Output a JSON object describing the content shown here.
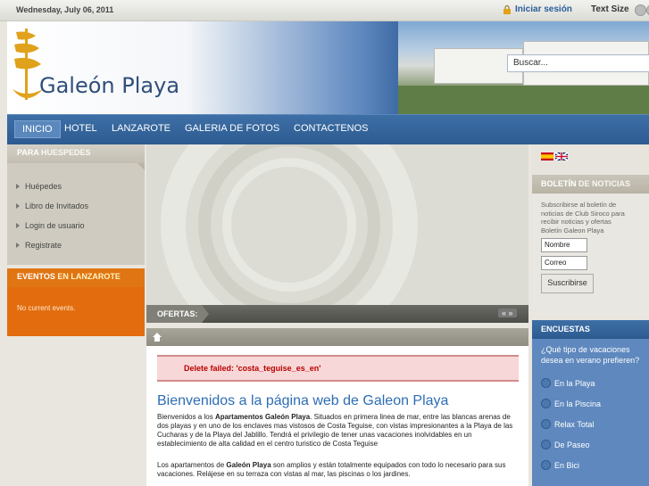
{
  "topbar": {
    "date": "Wednesday, July 06, 2011",
    "login": "Iniciar sesión",
    "text_size": "Text Size"
  },
  "header": {
    "logo_text": "Galeón Playa",
    "search_placeholder": "Buscar..."
  },
  "nav": {
    "items": [
      "INICIO",
      "HOTEL",
      "LANZAROTE",
      "GALERIA DE FOTOS",
      "CONTACTENOS"
    ]
  },
  "left": {
    "guest_title_a": "PARA ",
    "guest_title_b": "HUESPEDES",
    "menu": [
      "Huépedes",
      "Libro de Invitados",
      "Login de usuario",
      "Registrate"
    ],
    "events_title_a": "EVENTOS ",
    "events_title_b": "EN LANZAROTE",
    "events_text": "No current events."
  },
  "center": {
    "ofertas_label": "OFERTAS:",
    "arrows": "« »",
    "error": "Delete failed: 'costa_teguise_es_en'",
    "welcome": "Bienvenidos a la página web de Galeon Playa",
    "p1_a": "Bienvenidos a los ",
    "p1_b": "Apartamentos Galeón Playa",
    "p1_c": ". Situados en primera linea de mar, entre las blancas arenas de dos playas y en uno de los enclaves mas vistosos de Costa Teguise, con vistas impresionantes a la Playa de las Cucharas y de la Playa del Jablillo. Tendrá el privilegio de tener unas vacaciones inolvidables en un establecimiento de alta calidad en el centro turistico de Costa Teguise",
    "p2_a": "Los apartamentos de ",
    "p2_b": "Galeón Playa",
    "p2_c": " son amplios y están totalmente equipados con todo lo necesario para sus vacaciones. Relájese en su terraza con vistas al mar, las piscinas o los jardines."
  },
  "right": {
    "bol_title_a": "BOLETÍN ",
    "bol_title_b": "DE NOTICIAS",
    "bol_text": "Subscribirse al boletín de noticias de Club Siroco para recibir noticias y ofertas",
    "bol_sub": "Boletín Galeon Playa",
    "name_value": "Nombre",
    "email_value": "Correo",
    "subscribe": "Suscribirse",
    "enc_title": "ENCUESTAS",
    "enc_question": "¿Qué tipo de vacaciones desea en verano prefieren?",
    "options": [
      "En la Playa",
      "En la Piscina",
      "Relax Total",
      "De Paseo",
      "En Bici"
    ]
  },
  "colors": {
    "nav_blue": "#2d5b91",
    "events_orange": "#e36d0e",
    "title_blue": "#2e6db4",
    "error_red": "#b00000"
  }
}
